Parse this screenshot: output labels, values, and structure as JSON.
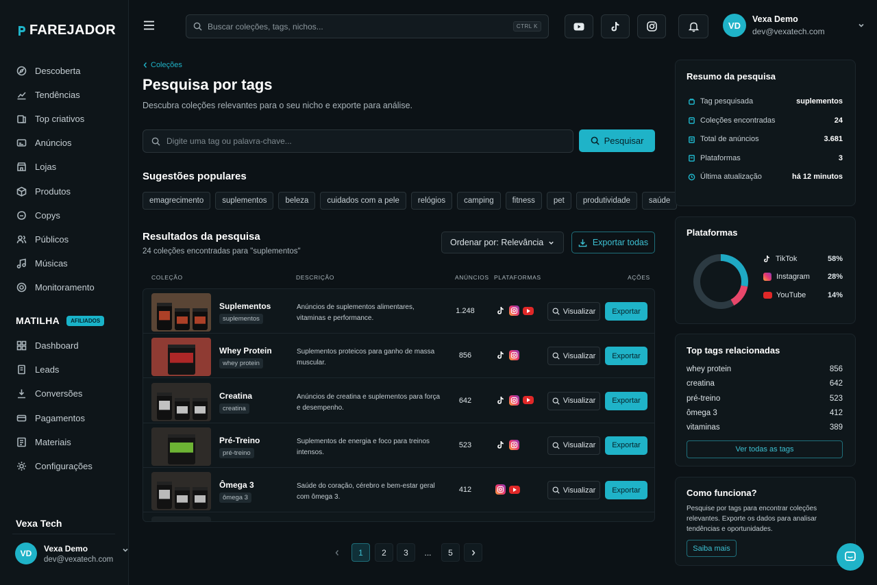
{
  "brand": {
    "name": "FAREJADOR"
  },
  "nav": [
    {
      "label": "Descoberta",
      "icon": "compass-icon"
    },
    {
      "label": "Tendências",
      "icon": "trend-icon"
    },
    {
      "label": "Top criativos",
      "icon": "creative-icon"
    },
    {
      "label": "Anúncios",
      "icon": "ads-icon"
    },
    {
      "label": "Lojas",
      "icon": "store-icon"
    },
    {
      "label": "Produtos",
      "icon": "box-icon"
    },
    {
      "label": "Copys",
      "icon": "copy-icon"
    },
    {
      "label": "Públicos",
      "icon": "audience-icon"
    },
    {
      "label": "Músicas",
      "icon": "music-icon"
    },
    {
      "label": "Monitoramento",
      "icon": "monitor-icon"
    }
  ],
  "matilha": {
    "title": "MATILHA",
    "badge": "AFILIADOS"
  },
  "nav2": [
    {
      "label": "Dashboard",
      "icon": "dashboard-icon"
    },
    {
      "label": "Leads",
      "icon": "leads-icon"
    },
    {
      "label": "Conversões",
      "icon": "conversion-icon"
    },
    {
      "label": "Pagamentos",
      "icon": "payment-icon"
    },
    {
      "label": "Materiais",
      "icon": "materials-icon"
    },
    {
      "label": "Configurações",
      "icon": "gear-icon"
    }
  ],
  "org": "Vexa Tech",
  "user": {
    "initials": "VD",
    "name": "Vexa Demo",
    "email": "dev@vexatech.com"
  },
  "topbar": {
    "search_placeholder": "Buscar coleções, tags, nichos...",
    "shortcut": "CTRL K"
  },
  "breadcrumb": "Coleções",
  "page": {
    "title": "Pesquisa por tags",
    "subtitle": "Descubra coleções relevantes para o seu nicho e exporte para análise."
  },
  "search": {
    "placeholder": "Digite uma tag ou palavra-chave...",
    "button": "Pesquisar"
  },
  "suggestions": {
    "title": "Sugestões populares",
    "chips": [
      "emagrecimento",
      "suplementos",
      "beleza",
      "cuidados com a pele",
      "relógios",
      "camping",
      "fitness",
      "pet",
      "produtividade",
      "saúde"
    ]
  },
  "results": {
    "title": "Resultados da pesquisa",
    "subtitle": "24 coleções encontradas para \"suplementos\"",
    "sort": "Ordenar por: Relevância",
    "export_all": "Exportar todas"
  },
  "table": {
    "headers": [
      "COLEÇÃO",
      "DESCRIÇÃO",
      "ANÚNCIOS",
      "PLATAFORMAS",
      "AÇÕES"
    ],
    "view_label": "Visualizar",
    "export_label": "Exportar",
    "rows": [
      {
        "name": "Suplementos",
        "tag": "suplementos",
        "desc": "Anúncios de suplementos alimentares, vitaminas e performance.",
        "count": "1.248",
        "platforms": [
          "tiktok",
          "instagram",
          "youtube"
        ]
      },
      {
        "name": "Whey Protein",
        "tag": "whey protein",
        "desc": "Suplementos proteicos para ganho de massa muscular.",
        "count": "856",
        "platforms": [
          "tiktok",
          "instagram"
        ]
      },
      {
        "name": "Creatina",
        "tag": "creatina",
        "desc": "Anúncios de creatina e suplementos para força e desempenho.",
        "count": "642",
        "platforms": [
          "tiktok",
          "instagram",
          "youtube"
        ]
      },
      {
        "name": "Pré-Treino",
        "tag": "pré-treino",
        "desc": "Suplementos de energia e foco para treinos intensos.",
        "count": "523",
        "platforms": [
          "tiktok",
          "instagram"
        ]
      },
      {
        "name": "Ômega 3",
        "tag": "ômega 3",
        "desc": "Saúde do coração, cérebro e bem-estar geral com ômega 3.",
        "count": "412",
        "platforms": [
          "instagram",
          "youtube"
        ]
      }
    ]
  },
  "pagination": [
    "1",
    "2",
    "3",
    "...",
    "5"
  ],
  "summary": {
    "title": "Resumo da pesquisa",
    "rows": [
      {
        "label": "Tag pesquisada",
        "value": "suplementos"
      },
      {
        "label": "Coleções encontradas",
        "value": "24"
      },
      {
        "label": "Total de anúncios",
        "value": "3.681"
      },
      {
        "label": "Plataformas",
        "value": "3"
      },
      {
        "label": "Última atualização",
        "value": "há 12 minutos"
      }
    ]
  },
  "platforms": {
    "title": "Plataformas",
    "items": [
      {
        "name": "TikTok",
        "value": "58%",
        "pct": 58,
        "color": "#2c3a42"
      },
      {
        "name": "Instagram",
        "value": "28%",
        "pct": 28,
        "color": "#1fa9c4"
      },
      {
        "name": "YouTube",
        "value": "14%",
        "pct": 14,
        "color": "#e8476a"
      }
    ]
  },
  "related": {
    "title": "Top tags relacionadas",
    "items": [
      {
        "tag": "whey protein",
        "count": "856"
      },
      {
        "tag": "creatina",
        "count": "642"
      },
      {
        "tag": "pré-treino",
        "count": "523"
      },
      {
        "tag": "ômega 3",
        "count": "412"
      },
      {
        "tag": "vitaminas",
        "count": "389"
      }
    ],
    "button": "Ver todas as tags"
  },
  "how": {
    "title": "Como funciona?",
    "text": "Pesquise por tags para encontrar coleções relevantes. Exporte os dados para analisar tendências e oportunidades.",
    "button": "Saiba mais"
  },
  "colors": {
    "accent": "#1fb3c8",
    "bg": "#0c1216"
  }
}
